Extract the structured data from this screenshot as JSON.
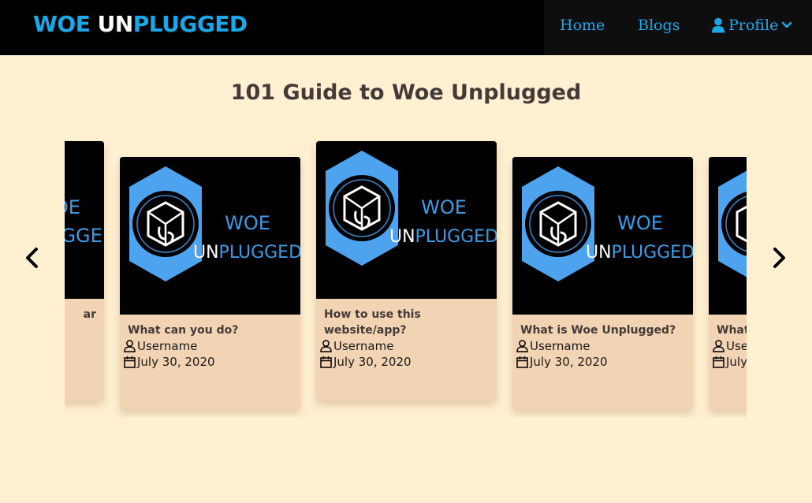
{
  "brand": {
    "part1": "WOE ",
    "part2": "UN",
    "part3": "PLUGGED"
  },
  "nav": {
    "home": "Home",
    "blogs": "Blogs",
    "profile": "Profile"
  },
  "page_title": "101 Guide to Woe Unplugged",
  "logo_text": {
    "line1": "WOE",
    "line2a": "UN",
    "line2b": "PLUGGED"
  },
  "cards": [
    {
      "title": "What can you do?",
      "author": "Username",
      "date": "July 30, 2020"
    },
    {
      "title": "How to use this website/app?",
      "author": "Username",
      "date": "July 30, 2020"
    },
    {
      "title": "What is Woe Unplugged?",
      "author": "Username",
      "date": "July 30, 2020"
    },
    {
      "title": "What",
      "author": "Use",
      "date": "July"
    }
  ],
  "partial_left_card": {
    "title_fragment": "ar"
  },
  "colors": {
    "accent": "#1ba8e8",
    "background": "#fff0d2",
    "card": "#f2d3b3",
    "title": "#443a37"
  },
  "icons": [
    "user-icon",
    "chevron-down-icon",
    "chevron-left-icon",
    "chevron-right-icon",
    "calendar-icon"
  ]
}
